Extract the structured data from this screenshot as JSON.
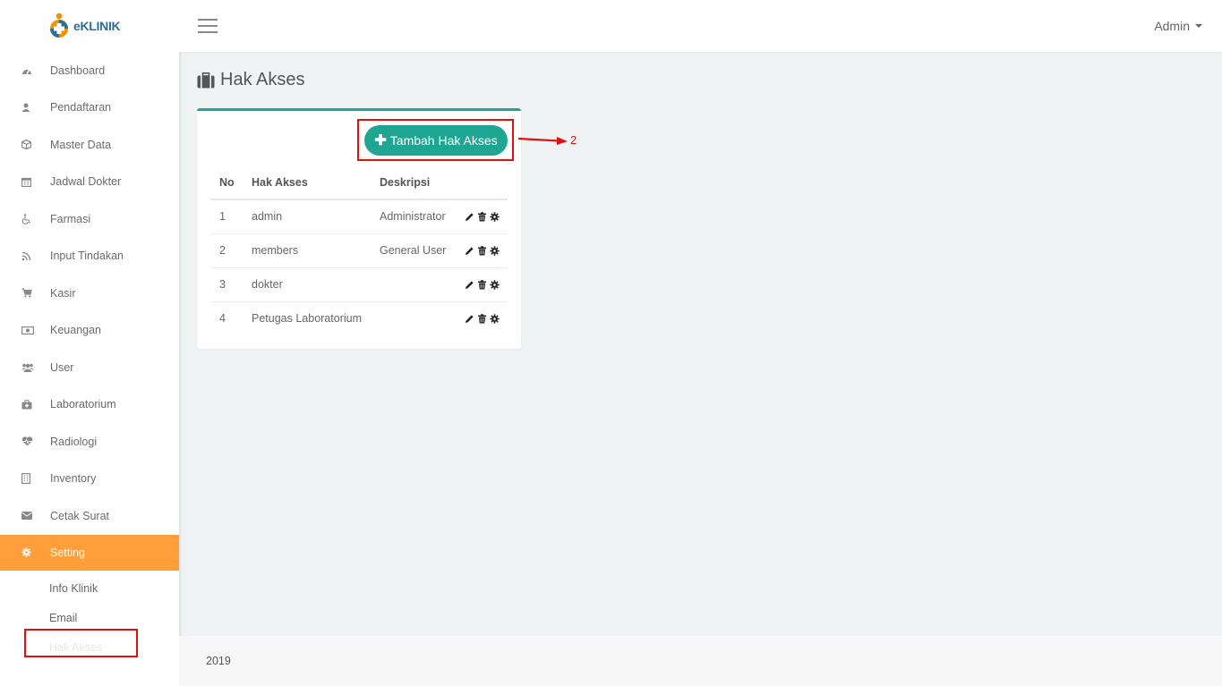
{
  "brand": {
    "name": "eKLINIK"
  },
  "header": {
    "user_label": "Admin"
  },
  "sidebar": {
    "items": [
      {
        "label": "Dashboard",
        "icon": "dashboard-icon"
      },
      {
        "label": "Pendaftaran",
        "icon": "user-icon"
      },
      {
        "label": "Master Data",
        "icon": "cube-icon"
      },
      {
        "label": "Jadwal Dokter",
        "icon": "calendar-icon"
      },
      {
        "label": "Farmasi",
        "icon": "wheelchair-icon"
      },
      {
        "label": "Input Tindakan",
        "icon": "rss-icon"
      },
      {
        "label": "Kasir",
        "icon": "cart-icon"
      },
      {
        "label": "Keuangan",
        "icon": "money-icon"
      },
      {
        "label": "User",
        "icon": "users-icon"
      },
      {
        "label": "Laboratorium",
        "icon": "medkit-icon"
      },
      {
        "label": "Radiologi",
        "icon": "heartbeat-icon"
      },
      {
        "label": "Inventory",
        "icon": "building-icon"
      },
      {
        "label": "Cetak Surat",
        "icon": "envelope-icon"
      },
      {
        "label": "Setting",
        "icon": "gear-icon"
      }
    ],
    "setting_sub": [
      "Info Klinik",
      "Email",
      "Hak Akses"
    ]
  },
  "page": {
    "title": "Hak Akses"
  },
  "card": {
    "add_button_label": "Tambah Hak Akses",
    "columns": [
      "No",
      "Hak Akses",
      "Deskripsi"
    ],
    "rows": [
      {
        "no": "1",
        "name": "admin",
        "desc": "Administrator"
      },
      {
        "no": "2",
        "name": "members",
        "desc": "General User"
      },
      {
        "no": "3",
        "name": "dokter",
        "desc": ""
      },
      {
        "no": "4",
        "name": "Petugas Laboratorium",
        "desc": ""
      }
    ]
  },
  "annotation": {
    "step_number": "2"
  },
  "footer": {
    "text": "2019"
  },
  "colors": {
    "accent": "#1ea693",
    "active_menu": "#ff9f3a",
    "annotation": "#e01010"
  }
}
